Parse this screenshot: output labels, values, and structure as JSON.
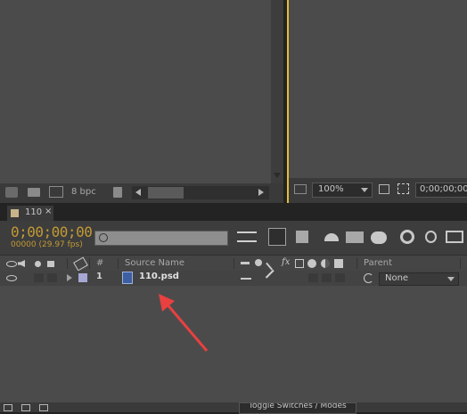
{
  "project_panel": {
    "bit_depth": "8 bpc"
  },
  "viewer_panel": {
    "zoom": "100%",
    "timecode": "0;00;00;00"
  },
  "timeline": {
    "tab_label": "110",
    "current_time": "0;00;00;00",
    "frame_info": "00000 (29.97 fps)",
    "search_placeholder": "",
    "col_source_name": "Source Name",
    "col_number": "#",
    "col_parent": "Parent",
    "layers": [
      {
        "number": "1",
        "name": "110.psd",
        "parent": "None"
      }
    ],
    "footer_toggle": "Toggle Switches / Modes"
  },
  "colors": {
    "timecode": "#c39a34",
    "accent_yellow": "#e2bd38",
    "arrow": "#e94040"
  }
}
